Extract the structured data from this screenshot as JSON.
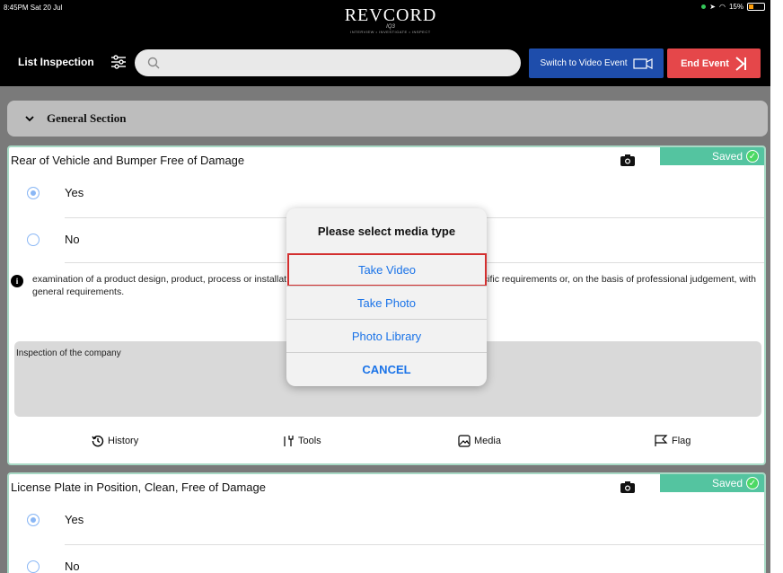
{
  "status_bar": {
    "time": "8:45PM  Sat 20 Jul",
    "battery": "15%"
  },
  "logo": {
    "main": "REVCORD",
    "sub": "IQ3",
    "tagline": "INTERVIEW • INVESTIGATE • INSPECT"
  },
  "header": {
    "title": "List Inspection",
    "search_placeholder": "",
    "switch_label": "Switch to Video Event",
    "end_label": "End Event"
  },
  "section": {
    "title": "General Section"
  },
  "cards": [
    {
      "question": "Rear of Vehicle and Bumper Free of Damage",
      "saved": "Saved",
      "options": [
        "Yes",
        "No"
      ],
      "selected": 0,
      "info": "examination of a product design, product, process or installation and determination of its conformity with specific requirements or, on the basis of professional judgement, with general requirements.",
      "comment": "Inspection of the company",
      "tools": {
        "history": "History",
        "tools": "Tools",
        "media": "Media",
        "flag": "Flag"
      }
    },
    {
      "question": "License Plate in Position, Clean, Free of Damage",
      "saved": "Saved",
      "options": [
        "Yes",
        "No"
      ],
      "selected": 0
    }
  ],
  "dialog": {
    "title": "Please select media type",
    "options": [
      "Take Video",
      "Take Photo",
      "Photo Library"
    ],
    "cancel": "CANCEL"
  },
  "colors": {
    "accent_blue": "#1e4dab",
    "end_red": "#e5474a",
    "saved_green": "#54c4a0",
    "highlight_red": "#d32f2f"
  }
}
